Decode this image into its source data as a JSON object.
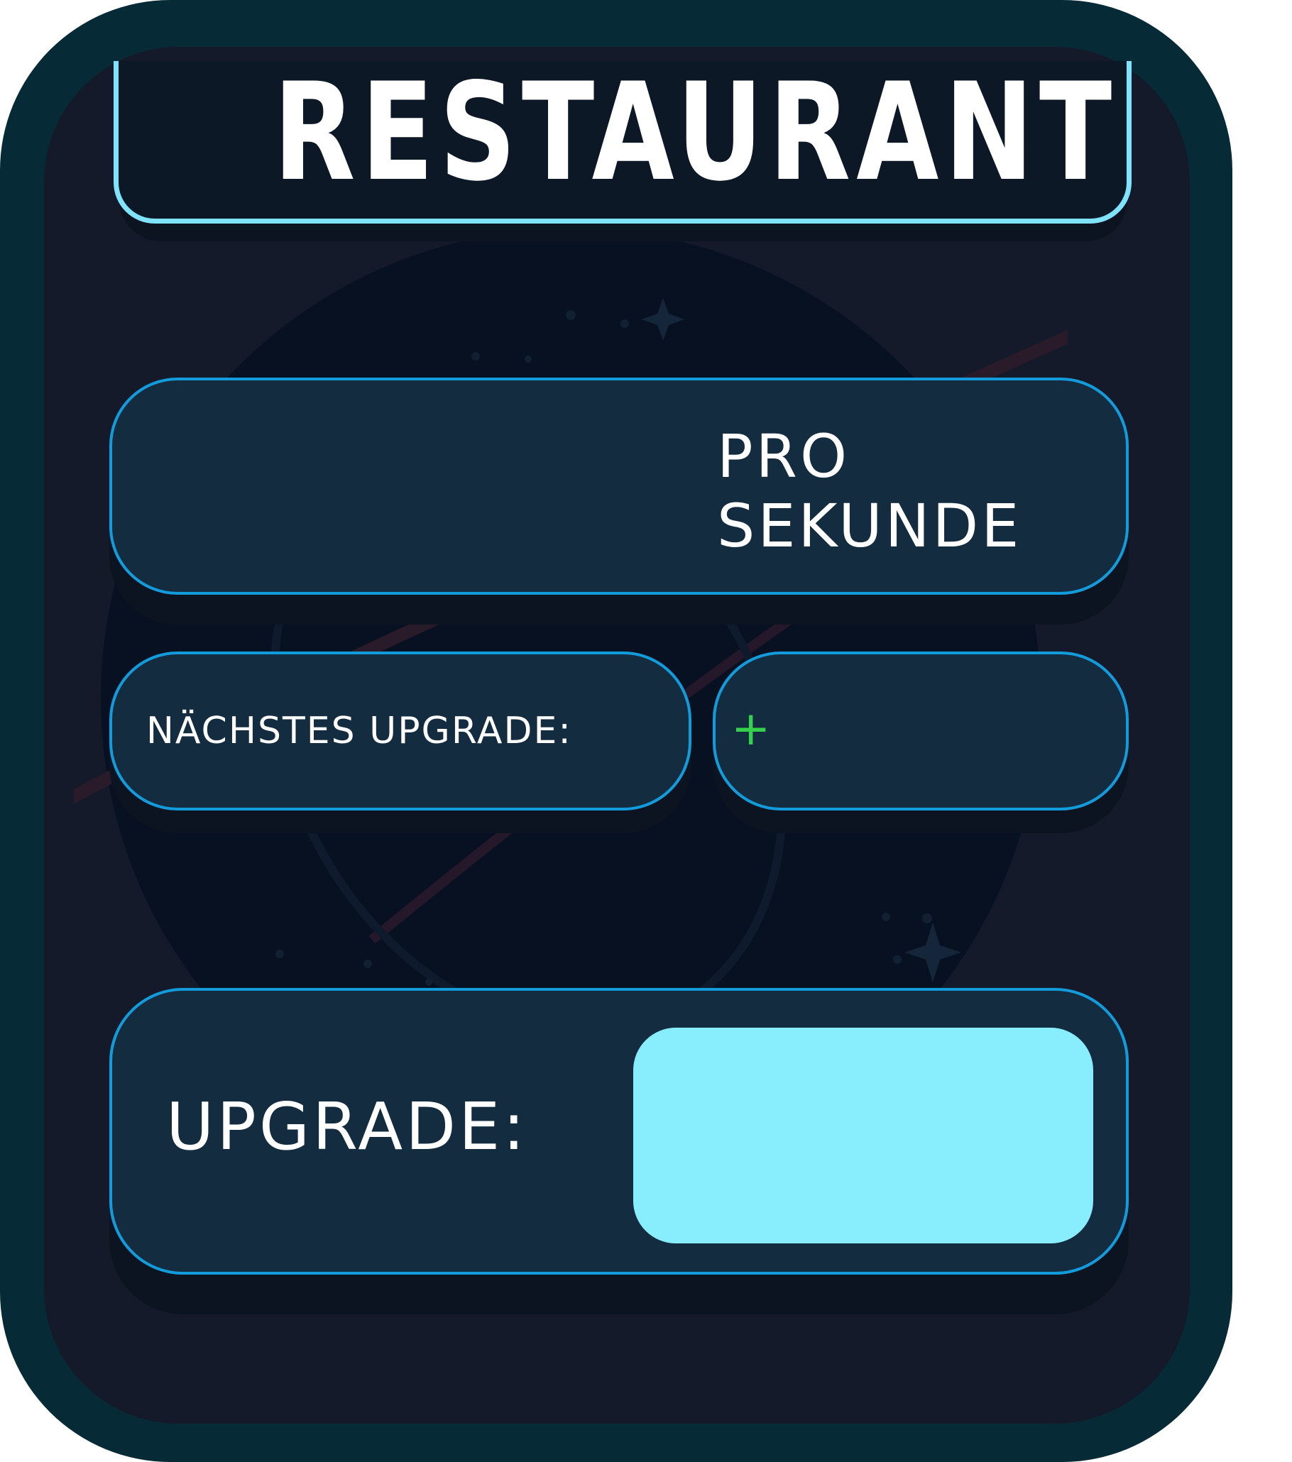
{
  "colors": {
    "card_frame": "#062b36",
    "card_background": "#141a2a",
    "title_border": "#7fe3fb",
    "panel_border": "#139cdc",
    "panel_fill": "#132c40",
    "upgrade_button": "#88eefe",
    "plus_sign": "#35d04c",
    "text": "#ffffff"
  },
  "header": {
    "title": "RESTAURANT"
  },
  "income": {
    "label": "PRO\nSEKUNDE"
  },
  "next_upgrade": {
    "label": "NÄCHSTES UPGRADE:",
    "bonus_prefix": "+"
  },
  "upgrade": {
    "label": "UPGRADE:"
  }
}
